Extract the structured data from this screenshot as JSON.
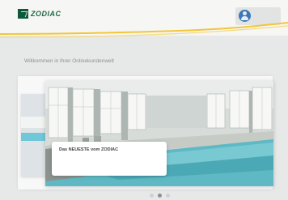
{
  "header": {
    "logo_text": "ZODIAC",
    "user": {
      "line1": "",
      "line2": ""
    }
  },
  "welcome": {
    "text": "Willkommen in Ihrer Onlinekundenwelt"
  },
  "news": {
    "title": "Das NEUESTE vom ZODIAC",
    "text": "",
    "link": ""
  },
  "carousel": {
    "total": 3,
    "active": 2
  },
  "colors": {
    "accent_yellow": "#f2c63a",
    "brand_green": "#0d5a3b",
    "user_blue": "#3a78b8",
    "pool_water": "#5fb9c4"
  }
}
